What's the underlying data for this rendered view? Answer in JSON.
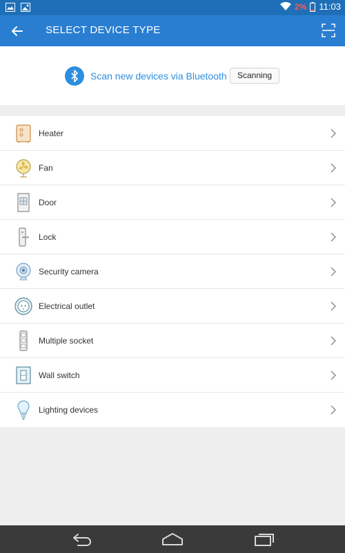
{
  "status_bar": {
    "battery_percent": "2%",
    "time": "11:03"
  },
  "app_bar": {
    "title": "SELECT DEVICE TYPE"
  },
  "bluetooth": {
    "scan_text": "Scan new devices via Bluetooth",
    "status_label": "Scanning"
  },
  "devices": [
    {
      "label": "Heater"
    },
    {
      "label": "Fan"
    },
    {
      "label": "Door"
    },
    {
      "label": "Lock"
    },
    {
      "label": "Security camera"
    },
    {
      "label": "Electrical outlet"
    },
    {
      "label": "Multiple socket"
    },
    {
      "label": "Wall switch"
    },
    {
      "label": "Lighting devices"
    }
  ],
  "colors": {
    "status_bar": "#1f6fb8",
    "app_bar": "#2a7ed1",
    "accent": "#2d8ee0",
    "battery_low": "#ff5a4d"
  }
}
